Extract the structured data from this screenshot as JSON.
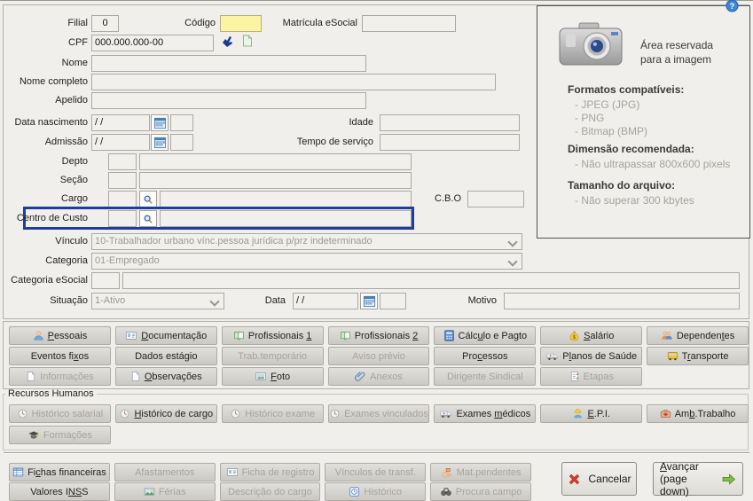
{
  "fields": {
    "filial_label": "Filial",
    "filial_value": "0",
    "codigo_label": "Código",
    "matricula_label": "Matrícula eSocial",
    "cpf_label": "CPF",
    "cpf_value": "000.000.000-00",
    "cpf_icon1": "validate-icon",
    "cpf_icon2": "copy-page-icon",
    "nome_label": "Nome",
    "nome_completo_label": "Nome completo",
    "apelido_label": "Apelido",
    "data_nascimento_label": "Data nascimento",
    "data_nascimento_value": "/ /",
    "idade_label": "Idade",
    "admissao_label": "Admissão",
    "admissao_value": "/ /",
    "tempo_servico_label": "Tempo de serviço",
    "depto_label": "Depto",
    "secao_label": "Seção",
    "cargo_label": "Cargo",
    "cbo_label": "C.B.O",
    "centro_custo_label": "Centro de Custo",
    "vinculo_label": "Vínculo",
    "vinculo_value": "10-Trabalhador urbano vínc.pessoa jurídica p/prz indeterminado",
    "categoria_label": "Categoria",
    "categoria_value": "01-Empregado",
    "categoria_esocial_label": "Categoria eSocial",
    "situacao_label": "Situação",
    "situacao_value": "1-Ativo",
    "data_label": "Data",
    "data_value": "/ /",
    "motivo_label": "Motivo",
    "calendar_icon": "calendar-icon",
    "magnifier_icon": "magnifier-icon"
  },
  "image_panel": {
    "camera_icon": "camera-icon",
    "help_icon": "help-icon",
    "area_line1": "Área reservada",
    "area_line2": "para a imagem",
    "formats_title": "Formatos compatíveis:",
    "formats": [
      "- JPEG (JPG)",
      "- PNG",
      "- Bitmap (BMP)"
    ],
    "dimension_title": "Dimensão recomendada:",
    "dimension_items": [
      "- Não ultrapassar 800x600 pixels"
    ],
    "size_title": "Tamanho do arquivo:",
    "size_items": [
      "- Não superar 300 kbytes"
    ]
  },
  "tab_buttons": [
    [
      {
        "label": "Pessoais",
        "u": [
          0,
          1
        ],
        "icon": "person-icon",
        "enabled": true
      },
      {
        "label": "Documentação",
        "u": [
          0,
          1
        ],
        "icon": "id-card-icon",
        "enabled": true
      },
      {
        "label": "Profissionais 1",
        "u": [
          14,
          1
        ],
        "icon": "book-icon",
        "enabled": true
      },
      {
        "label": "Profissionais 2",
        "u": [
          14,
          1
        ],
        "icon": "book-icon",
        "enabled": true
      },
      {
        "label": "Cálculo e Pagto",
        "u": [
          4,
          1
        ],
        "icon": "calculator-icon",
        "enabled": true
      },
      {
        "label": "Salário",
        "u": [
          0,
          1
        ],
        "icon": "money-bag-icon",
        "enabled": true
      },
      {
        "label": "Dependentes",
        "u": [
          8,
          1
        ],
        "icon": "people-icon",
        "enabled": true
      }
    ],
    [
      {
        "label": "Eventos fixos",
        "u": [
          10,
          1
        ],
        "icon": null,
        "enabled": true
      },
      {
        "label": "Dados estágio",
        "u": [
          10,
          1
        ],
        "icon": null,
        "enabled": true
      },
      {
        "label": "Trab.temporário",
        "u": null,
        "icon": null,
        "enabled": false
      },
      {
        "label": "Aviso prévio",
        "u": null,
        "icon": null,
        "enabled": false
      },
      {
        "label": "Processos",
        "u": [
          3,
          1
        ],
        "icon": null,
        "enabled": true
      },
      {
        "label": "Planos de Saúde",
        "u": [
          1,
          1
        ],
        "icon": "ambulance-icon",
        "enabled": true
      },
      {
        "label": "Transporte",
        "u": [
          1,
          1
        ],
        "icon": "bus-icon",
        "enabled": true
      }
    ],
    [
      {
        "label": "Informações",
        "u": null,
        "icon": "document-icon",
        "enabled": false
      },
      {
        "label": "Observações",
        "u": [
          0,
          1
        ],
        "icon": "document-icon",
        "enabled": true
      },
      {
        "label": "Foto",
        "u": [
          0,
          1
        ],
        "icon": "photo-icon",
        "enabled": true
      },
      {
        "label": "Anexos",
        "u": null,
        "icon": "paperclip-icon",
        "enabled": false
      },
      {
        "label": "Dirigente Sindical",
        "u": null,
        "icon": null,
        "enabled": false
      },
      {
        "label": "Etapas",
        "u": null,
        "icon": "checklist-icon",
        "enabled": false
      },
      null
    ]
  ],
  "rh_section": {
    "title": "Recursos Humanos",
    "rows": [
      [
        {
          "label": "Histórico salarial",
          "u": null,
          "icon": "history-icon",
          "enabled": false
        },
        {
          "label": "Histórico de cargo",
          "u": [
            0,
            1
          ],
          "icon": "history-icon",
          "enabled": true
        },
        {
          "label": "Histórico exame",
          "u": null,
          "icon": "history-icon",
          "enabled": false
        },
        {
          "label": "Exames vinculados",
          "u": null,
          "icon": "history-icon",
          "enabled": false
        },
        {
          "label": "Exames médicos",
          "u": [
            7,
            1
          ],
          "icon": "ambulance-icon",
          "enabled": true
        },
        {
          "label": "E.P.I.",
          "u": [
            0,
            1
          ],
          "icon": "worker-icon",
          "enabled": true
        },
        {
          "label": "Amb.Trabalho",
          "u": [
            2,
            1
          ],
          "icon": "first-aid-icon",
          "enabled": true
        }
      ],
      [
        {
          "label": "Formações",
          "u": null,
          "icon": "graduation-cap-icon",
          "enabled": false
        },
        null,
        null,
        null,
        null,
        null,
        null
      ]
    ]
  },
  "bottom_buttons": [
    [
      {
        "label": "Fichas financeiras",
        "u": [
          2,
          1
        ],
        "icon": "table-icon",
        "enabled": true
      },
      {
        "label": "Afastamentos",
        "u": null,
        "icon": null,
        "enabled": false
      },
      {
        "label": "Ficha de registro",
        "u": null,
        "icon": "id-card-icon",
        "enabled": false
      },
      {
        "label": "Vínculos de transf.",
        "u": null,
        "icon": null,
        "enabled": false
      },
      {
        "label": "Mat.pendentes",
        "u": null,
        "icon": "hand-icon",
        "enabled": false
      }
    ],
    [
      {
        "label": "Valores INSS",
        "u": [
          9,
          2
        ],
        "icon": null,
        "enabled": true
      },
      {
        "label": "Férias",
        "u": null,
        "icon": "vacation-icon",
        "enabled": false
      },
      {
        "label": "Descrição do cargo",
        "u": [
          16,
          1
        ],
        "icon": null,
        "enabled": false
      },
      {
        "label": "Histórico",
        "u": null,
        "icon": "clock-icon",
        "enabled": false
      },
      {
        "label": "Procura campo",
        "u": null,
        "icon": "binoculars-icon",
        "enabled": false
      }
    ]
  ],
  "actions": {
    "cancel": {
      "label": "Cancelar",
      "icon": "cancel-x-icon"
    },
    "advance": {
      "label": "Avançar",
      "u": [
        0,
        1
      ],
      "sub": "(page down)",
      "icon": "green-arrow-icon"
    }
  },
  "colors": {
    "highlight_border": "#1E3D9E",
    "required_field_bg": "#FBF5A3",
    "disabled_text": "#A6A39D"
  }
}
